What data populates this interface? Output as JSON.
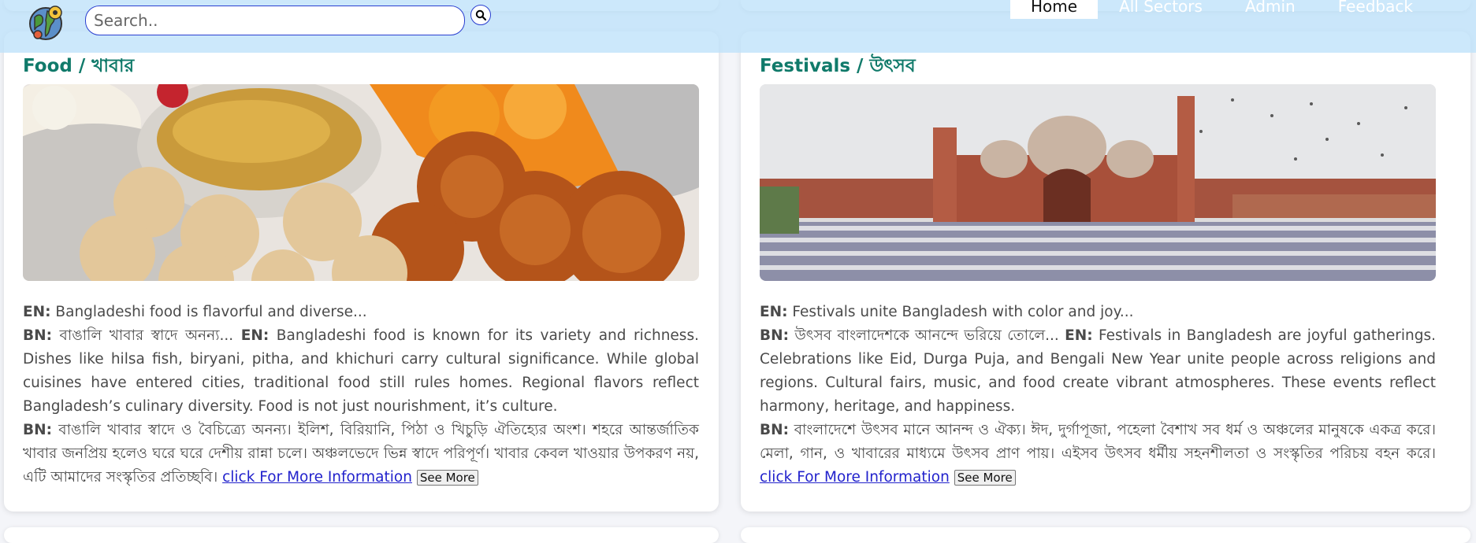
{
  "search": {
    "placeholder": "Search.."
  },
  "nav": {
    "items": [
      {
        "label": "Home",
        "active": true
      },
      {
        "label": "All Sectors",
        "active": false
      },
      {
        "label": "Admin",
        "active": false
      },
      {
        "label": "Feedback",
        "active": false
      }
    ]
  },
  "cards": [
    {
      "title": "Food / খাবার",
      "image_alt": "food-photo",
      "en_label": "EN:",
      "en_text": "Bangladeshi food is flavorful and diverse...",
      "bn_label": "BN:",
      "bn_short": "বাঙালি খাবার স্বাদে অনন্য...",
      "en_label2": "EN:",
      "en_long": "Bangladeshi food is known for its variety and richness. Dishes like hilsa fish, biryani, pitha, and khichuri carry cultural significance. While global cuisines have entered cities, traditional food still rules homes. Regional flavors reflect Bangladesh’s culinary diversity. Food is not just nourishment, it’s culture.",
      "bn_label2": "BN:",
      "bn_long": "বাঙালি খাবার স্বাদে ও বৈচিত্র্যে অনন্য। ইলিশ, বিরিয়ানি, পিঠা ও খিচুড়ি ঐতিহ্যের অংশ। শহরে আন্তর্জাতিক খাবার জনপ্রিয় হলেও ঘরে ঘরে দেশীয় রান্না চলে। অঞ্চলভেদে ভিন্ন স্বাদে পরিপূর্ণ। খাবার কেবল খাওয়ার উপকরণ নয়, এটি আমাদের সংস্কৃতির প্রতিচ্ছবি।",
      "link_text": "click For More Information",
      "button_text": "See More"
    },
    {
      "title": "Festivals / উৎসব",
      "image_alt": "festival-photo",
      "en_label": "EN:",
      "en_text": "Festivals unite Bangladesh with color and joy...",
      "bn_label": "BN:",
      "bn_short": "উৎসব বাংলাদেশকে আনন্দে ভরিয়ে তোলে...",
      "en_label2": "EN:",
      "en_long": "Festivals in Bangladesh are joyful gatherings. Celebrations like Eid, Durga Puja, and Bengali New Year unite people across religions and regions. Cultural fairs, music, and food create vibrant atmospheres. These events reflect harmony, heritage, and happiness.",
      "bn_label2": "BN:",
      "bn_long": "বাংলাদেশে উৎসব মানে আনন্দ ও ঐক্য। ঈদ, দুর্গাপূজা, পহেলা বৈশাখ সব ধর্ম ও অঞ্চলের মানুষকে একত্র করে। মেলা, গান, ও খাবারের মাধ্যমে উৎসব প্রাণ পায়। এইসব উৎসব ধর্মীয় সহনশীলতা ও সংস্কৃতির পরিচয় বহন করে।",
      "link_text": "click For More Information",
      "button_text": "See More"
    }
  ],
  "colors": {
    "title": "#107a6a",
    "link": "#2222cc",
    "navbar": "#bee2fa"
  }
}
